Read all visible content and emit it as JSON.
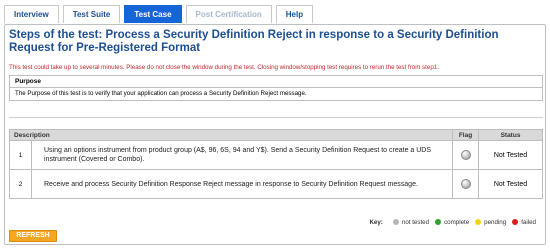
{
  "tabs": [
    {
      "label": "Interview",
      "state": "normal"
    },
    {
      "label": "Test Suite",
      "state": "normal"
    },
    {
      "label": "Test Case",
      "state": "active"
    },
    {
      "label": "Post Certification",
      "state": "disabled"
    },
    {
      "label": "Help",
      "state": "normal"
    }
  ],
  "page": {
    "title": "Steps of the test: Process a Security Definition Reject in response to a Security Definition Request for Pre-Registered Format",
    "warning": "This test could take up to several minutes. Please do not close the window during the test. Closing window/stopping test requires to rerun the test from step1."
  },
  "purpose": {
    "heading": "Purpose",
    "text": "The Purpose of this test is to verify that your application can process a Security Definition Reject message."
  },
  "steps_table": {
    "headers": {
      "description": "Description",
      "flag": "Flag",
      "status": "Status"
    },
    "rows": [
      {
        "num": "1",
        "description": "Using an options instrument from product group (A$, 96, 6S, 94 and Y$). Send a Security Definition Request to create a UDS instrument (Covered or Combo).",
        "flag_icon": "status-light-gray",
        "status": "Not Tested"
      },
      {
        "num": "2",
        "description": "Receive and process Security Definition Response Reject message in response to Security Definition Request message.",
        "flag_icon": "status-light-gray",
        "status": "Not Tested"
      }
    ]
  },
  "legend": {
    "key_label": "Key:",
    "items": [
      {
        "label": "not tested",
        "color": "#b5b5b5"
      },
      {
        "label": "complete",
        "color": "#2ea12e"
      },
      {
        "label": "pending",
        "color": "#f2d21b"
      },
      {
        "label": "failed",
        "color": "#d92020"
      }
    ]
  },
  "actions": {
    "refresh_label": "REFRESH"
  },
  "colors": {
    "accent": "#1665d8",
    "title": "#1d4f91",
    "warning": "#c1272d",
    "refresh": "#f5a623"
  }
}
